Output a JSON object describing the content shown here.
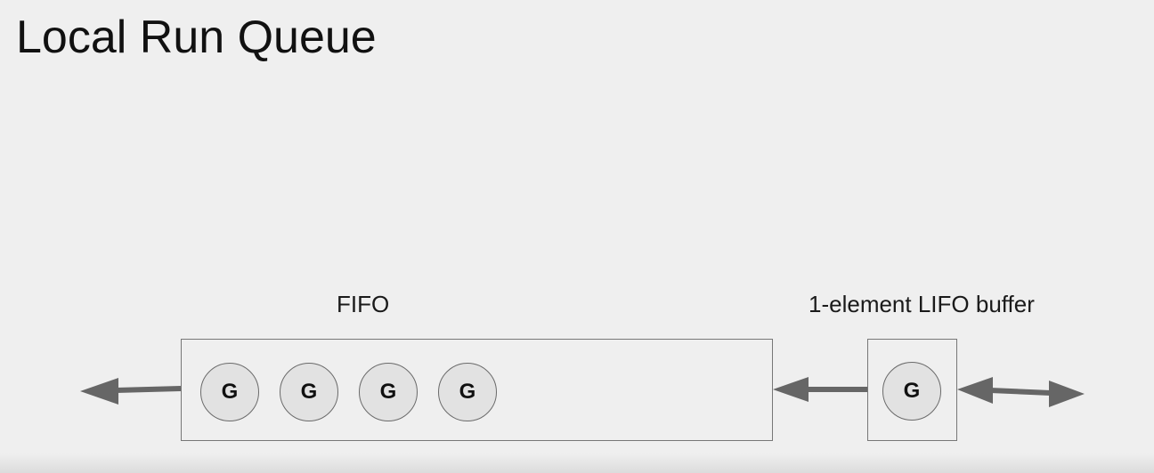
{
  "title": "Local Run Queue",
  "fifo": {
    "label": "FIFO",
    "items": [
      "G",
      "G",
      "G",
      "G"
    ]
  },
  "lifo": {
    "label": "1-element LIFO buffer",
    "item": "G"
  },
  "colors": {
    "background": "#efefef",
    "arrow": "#666666",
    "circle_fill": "#e2e2e2",
    "border": "#777777"
  }
}
